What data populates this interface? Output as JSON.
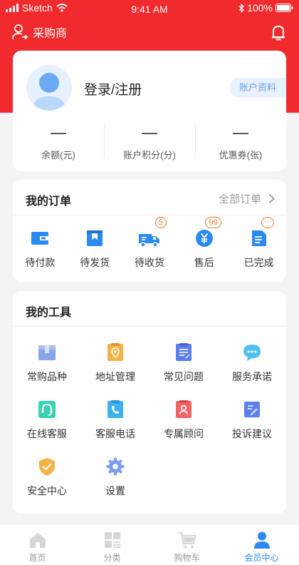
{
  "status_bar": {
    "carrier": "Sketch",
    "time": "9:41 AM",
    "battery": "100%"
  },
  "header": {
    "account_label": "采购商"
  },
  "profile": {
    "login_text": "登录/注册",
    "account_button": "账户资料",
    "stats": [
      {
        "value": "—",
        "label": "余额(元)"
      },
      {
        "value": "—",
        "label": "账户积分(分)"
      },
      {
        "value": "—",
        "label": "优惠券(张)"
      }
    ]
  },
  "orders": {
    "title": "我的订单",
    "all_label": "全部订单",
    "items": [
      {
        "label": "待付款",
        "icon": "wallet-icon",
        "badge": ""
      },
      {
        "label": "待发货",
        "icon": "package-icon",
        "badge": ""
      },
      {
        "label": "待收货",
        "icon": "truck-icon",
        "badge": "5"
      },
      {
        "label": "售后",
        "icon": "yen-coin-icon",
        "badge": "99"
      },
      {
        "label": "已完成",
        "icon": "document-icon",
        "badge": "···"
      }
    ]
  },
  "tools": {
    "title": "我的工具",
    "items": [
      {
        "label": "常购品种",
        "icon": "box-icon",
        "color": "#8aa4ec"
      },
      {
        "label": "地址管理",
        "icon": "location-card-icon",
        "color": "#f5b248"
      },
      {
        "label": "常见问题",
        "icon": "clipboard-icon",
        "color": "#5b7ff0"
      },
      {
        "label": "服务承诺",
        "icon": "chat-bubble-icon",
        "color": "#4fc1f0"
      },
      {
        "label": "在线客服",
        "icon": "headset-icon",
        "color": "#38d2b2"
      },
      {
        "label": "客服电话",
        "icon": "phone-icon",
        "color": "#3fb0f0"
      },
      {
        "label": "专属顾问",
        "icon": "advisor-icon",
        "color": "#f06464"
      },
      {
        "label": "投诉建议",
        "icon": "edit-icon",
        "color": "#5b7ff0"
      },
      {
        "label": "安全中心",
        "icon": "shield-icon",
        "color": "#f5b248"
      },
      {
        "label": "设置",
        "icon": "gear-icon",
        "color": "#7b9cf0"
      }
    ]
  },
  "tab_bar": {
    "items": [
      {
        "label": "首页",
        "icon": "home-icon",
        "active": false
      },
      {
        "label": "分类",
        "icon": "category-icon",
        "active": false
      },
      {
        "label": "购物车",
        "icon": "cart-icon",
        "active": false
      },
      {
        "label": "会员中心",
        "icon": "member-icon",
        "active": true
      }
    ]
  },
  "colors": {
    "brand_red": "#f02a2d",
    "accent_blue": "#2b8af0",
    "badge_orange": "#f07a2e"
  }
}
